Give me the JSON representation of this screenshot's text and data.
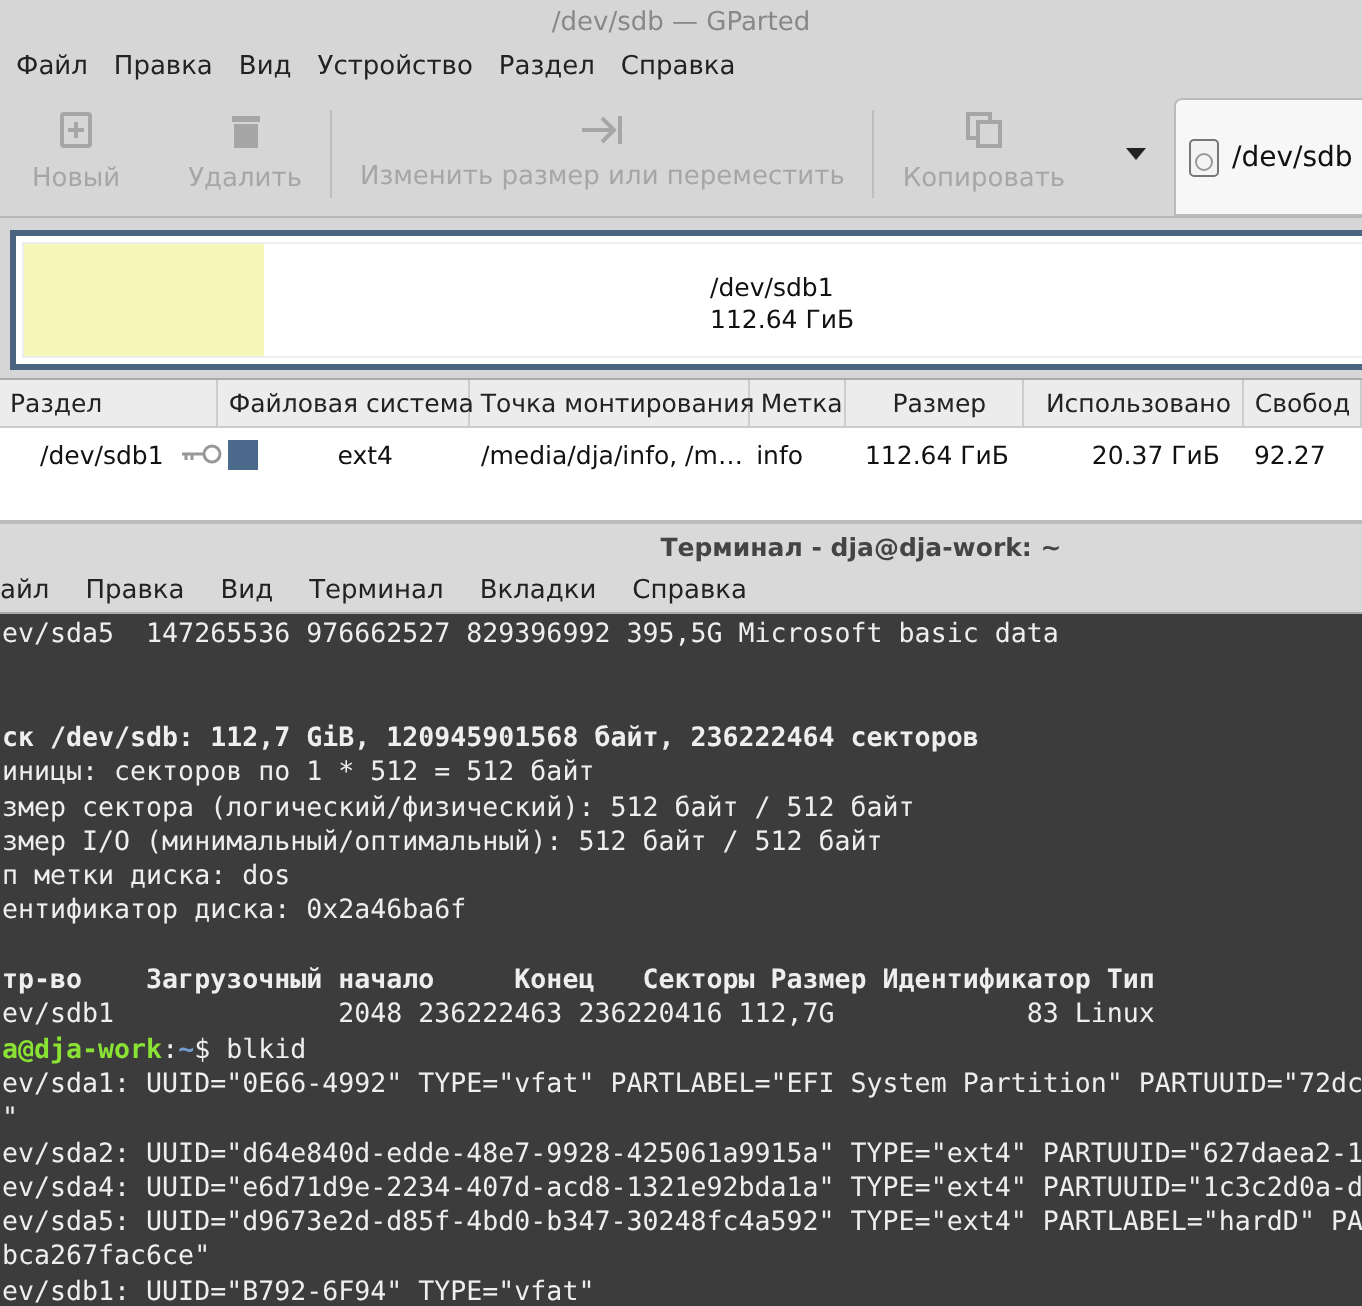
{
  "gparted": {
    "title": "/dev/sdb — GParted",
    "menu": [
      "Файл",
      "Правка",
      "Вид",
      "Устройство",
      "Раздел",
      "Справка"
    ],
    "toolbar": [
      {
        "kind": "new",
        "label": "Новый",
        "disabled": true
      },
      {
        "kind": "delete",
        "label": "Удалить",
        "disabled": true
      },
      {
        "kind": "sep"
      },
      {
        "kind": "resize",
        "label": "Изменить размер или переместить",
        "disabled": true
      },
      {
        "kind": "sep"
      },
      {
        "kind": "copy",
        "label": "Копировать",
        "disabled": true
      }
    ],
    "device": "/dev/sdb",
    "disk_map": {
      "name": "/dev/sdb1",
      "size": "112.64 ГиБ",
      "level": 0.18
    },
    "table": {
      "columns": [
        "Раздел",
        "Файловая система",
        "Точка монтирования",
        "Метка",
        "Размер",
        "Использовано",
        "Свобод"
      ],
      "rows": [
        {
          "partition": "/dev/sdb1",
          "mounted": true,
          "color": "#4b6a8c",
          "filesystem": "ext4",
          "mount_point": "/media/dja/info, /m…",
          "label": "info",
          "size": "112.64 ГиБ",
          "used": "20.37 ГиБ",
          "free": "92.27"
        }
      ]
    }
  },
  "terminal": {
    "title": "Терминал - dja@dja-work: ~",
    "menu": [
      "айл",
      "Правка",
      "Вид",
      "Терминал",
      "Вкладки",
      "Справка"
    ],
    "lines": [
      {
        "kind": "text",
        "text": "ev/sda5  147265536 976662527 829396992 395,5G Microsoft basic data"
      },
      {
        "kind": "blank"
      },
      {
        "kind": "blank"
      },
      {
        "kind": "bold",
        "text": "ск /dev/sdb: 112,7 GiB, 120945901568 байт, 236222464 секторов"
      },
      {
        "kind": "text",
        "text": "иницы: секторов по 1 * 512 = 512 байт"
      },
      {
        "kind": "text",
        "text": "змер сектора (логический/физический): 512 байт / 512 байт"
      },
      {
        "kind": "text",
        "text": "змер I/O (минимальный/оптимальный): 512 байт / 512 байт"
      },
      {
        "kind": "text",
        "text": "п метки диска: dos"
      },
      {
        "kind": "text",
        "text": "ентификатор диска: 0x2a46ba6f"
      },
      {
        "kind": "blank"
      },
      {
        "kind": "bold",
        "text": "тр-во    Загрузочный начало     Конец   Секторы Размер Идентификатор Тип"
      },
      {
        "kind": "text",
        "text": "ev/sdb1              2048 236222463 236220416 112,7G            83 Linux"
      },
      {
        "kind": "prompt",
        "user": "a@dja-work",
        "sep": ":",
        "path": "~",
        "command": "$ blkid"
      },
      {
        "kind": "text",
        "text": "ev/sda1: UUID=\"0E66-4992\" TYPE=\"vfat\" PARTLABEL=\"EFI System Partition\" PARTUUID=\"72dc"
      },
      {
        "kind": "text",
        "text": "\""
      },
      {
        "kind": "text",
        "text": "ev/sda2: UUID=\"d64e840d-edde-48e7-9928-425061a9915a\" TYPE=\"ext4\" PARTUUID=\"627daea2-1"
      },
      {
        "kind": "text",
        "text": "ev/sda4: UUID=\"e6d71d9e-2234-407d-acd8-1321e92bda1a\" TYPE=\"ext4\" PARTUUID=\"1c3c2d0a-d"
      },
      {
        "kind": "text",
        "text": "ev/sda5: UUID=\"d9673e2d-d85f-4bd0-b347-30248fc4a592\" TYPE=\"ext4\" PARTLABEL=\"hardD\" PA"
      },
      {
        "kind": "text",
        "text": "bca267fac6ce\""
      },
      {
        "kind": "text",
        "text": "ev/sdb1: UUID=\"B792-6F94\" TYPE=\"vfat\""
      }
    ]
  }
}
